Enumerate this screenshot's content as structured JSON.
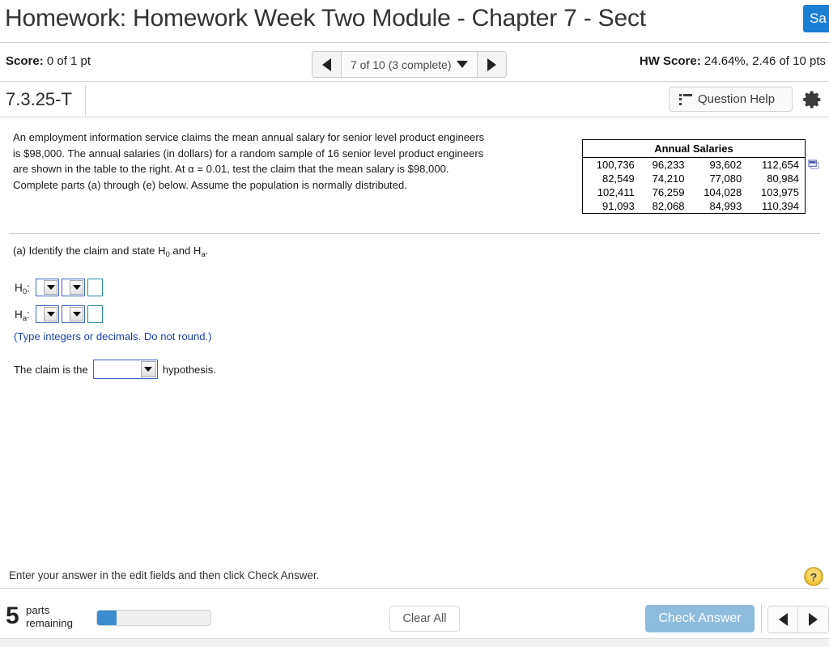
{
  "titlebar": {
    "title": "Homework: Homework Week Two Module - Chapter 7 - Sect",
    "save_label": "Sa"
  },
  "scorebar": {
    "score_label": "Score:",
    "score_value": " 0 of 1 pt",
    "nav": {
      "prev_icon": "triangle-left-icon",
      "next_icon": "triangle-right-icon",
      "label": "7 of 10 (3 complete)"
    },
    "hw_score_label": "HW Score:",
    "hw_score_value": " 24.64%, 2.46 of 10 pts"
  },
  "idbar": {
    "question_id": "7.3.25-T",
    "question_help_label": "Question Help",
    "question_help_icon": "list-icon",
    "gear_icon": "gear-icon"
  },
  "problem": {
    "lines": [
      "An employment information service claims the mean annual salary for senior level product engineers",
      "is $98,000. The annual salaries (in dollars) for a random sample of 16 senior level product engineers",
      "are shown in the table to the right. At α = 0.01, test the claim that the mean salary is $98,000.",
      "Complete parts (a) through (e) below. Assume the population is normally distributed."
    ],
    "popout_icon": "popout-window-icon"
  },
  "salaries_table": {
    "title": "Annual Salaries",
    "rows": [
      [
        "100,736",
        "96,233",
        "93,602",
        "112,654"
      ],
      [
        "82,549",
        "74,210",
        "77,080",
        "80,984"
      ],
      [
        "102,411",
        "76,259",
        "104,028",
        "103,975"
      ],
      [
        "91,093",
        "82,068",
        "84,993",
        "110,394"
      ]
    ]
  },
  "part_a": {
    "prompt_pre": "(a) Identify the claim and state H",
    "prompt_sub1": "0",
    "prompt_mid": " and H",
    "prompt_sub2": "a",
    "prompt_post": ".",
    "h0_label_pre": "H",
    "h0_label_sub": "0",
    "h0_label_post": ":",
    "ha_label_pre": "H",
    "ha_label_sub": "a",
    "ha_label_post": ":",
    "h0_dropdown1_value": "",
    "h0_dropdown2_value": "",
    "h0_textfield_value": "",
    "ha_dropdown1_value": "",
    "ha_dropdown2_value": "",
    "ha_textfield_value": "",
    "note": "(Type integers or decimals. Do not round.)",
    "claim_pre": "The claim is the",
    "claim_dropdown_value": "",
    "claim_post": "hypothesis."
  },
  "footer": {
    "hint": "Enter your answer in the edit fields and then click Check Answer.",
    "help_bubble_icon": "question-mark-icon",
    "help_bubble_glyph": "?",
    "parts_count": "5",
    "parts_line1": "parts",
    "parts_line2": "remaining",
    "progress_percent": 17,
    "clear_all_label": "Clear All",
    "check_answer_label": "Check Answer",
    "prev_icon": "triangle-left-icon",
    "next_icon": "triangle-right-icon"
  },
  "colors": {
    "save_blue": "#1b7fd4",
    "check_answer_blue": "#8fbcdd",
    "progress_blue": "#3a8dd0",
    "note_blue": "#1c3faa",
    "dropdown_border_blue": "#3f63c4",
    "textfield_border_teal": "#2a8a9e"
  }
}
